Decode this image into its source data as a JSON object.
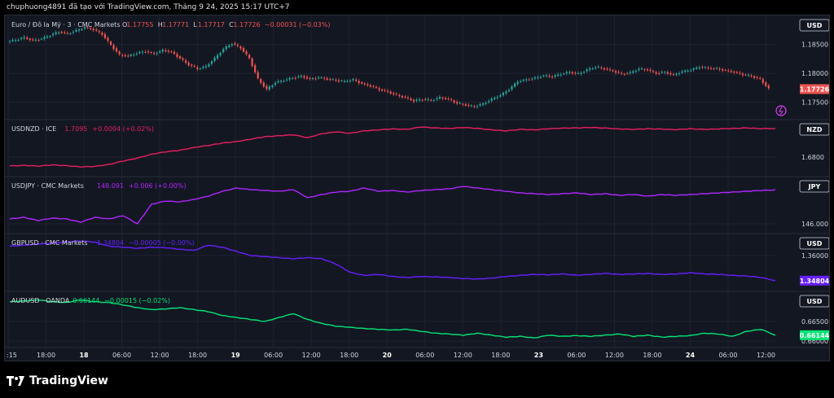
{
  "header": {
    "caption": "chuphuong4891 đã tạo với TradingView.com, Tháng 9 24, 2025 15:17 UTC+7"
  },
  "footer": {
    "brand": "TradingView"
  },
  "colors": {
    "background": "#131722",
    "grid": "#1f2330",
    "up": "#26a69a",
    "down": "#ef5350",
    "usdnzd": "#e91e63",
    "usdjpy": "#b026ff",
    "gbpusd": "#651fff",
    "audusd": "#00e676"
  },
  "chart_data": [
    {
      "id": "eurusd",
      "type": "candlestick",
      "title": "Euro / Đô la Mỹ · 3 · CMC Markets",
      "ohlc_labels": {
        "o_label": "O",
        "o": "1.17755",
        "h_label": "H",
        "h": "1.17771",
        "l_label": "L",
        "l": "1.17717",
        "c_label": "C",
        "c": "1.17726",
        "change": "−0.00031 (−0.03%)"
      },
      "currency": "USD",
      "ticks": [
        "1.18500",
        "1.18000",
        "1.17500"
      ],
      "tick_values": [
        1.185,
        1.18,
        1.175
      ],
      "ylim": [
        1.1728,
        1.1892
      ],
      "last_label": "1.17726",
      "last_value": 1.17726,
      "closes": [
        1.1855,
        1.1858,
        1.1862,
        1.1857,
        1.186,
        1.1866,
        1.1872,
        1.1869,
        1.1874,
        1.188,
        1.1876,
        1.1868,
        1.1849,
        1.1832,
        1.183,
        1.1835,
        1.1838,
        1.1834,
        1.184,
        1.1837,
        1.1826,
        1.1815,
        1.1808,
        1.1812,
        1.1826,
        1.1842,
        1.1852,
        1.1844,
        1.1826,
        1.179,
        1.1772,
        1.1784,
        1.1788,
        1.1792,
        1.1795,
        1.179,
        1.1793,
        1.179,
        1.1788,
        1.1786,
        1.1789,
        1.1782,
        1.1778,
        1.1772,
        1.1768,
        1.1762,
        1.1758,
        1.1752,
        1.1755,
        1.1753,
        1.1758,
        1.1755,
        1.1748,
        1.1745,
        1.1742,
        1.1747,
        1.1755,
        1.1762,
        1.1772,
        1.1786,
        1.1789,
        1.1792,
        1.1796,
        1.1794,
        1.1799,
        1.1802,
        1.1799,
        1.1806,
        1.1811,
        1.1808,
        1.1804,
        1.1799,
        1.1801,
        1.1808,
        1.1806,
        1.18,
        1.1802,
        1.1797,
        1.1803,
        1.1806,
        1.1811,
        1.1809,
        1.1808,
        1.1805,
        1.1802,
        1.1798,
        1.1795,
        1.179,
        1.1773
      ]
    },
    {
      "id": "usdnzd",
      "type": "line",
      "title": "USDNZD · ICE",
      "value": "1.7095",
      "change": "+0.0004 (+0.02%)",
      "currency": "NZD",
      "ticks": [
        "1.6800"
      ],
      "tick_values": [
        1.68
      ],
      "ylim": [
        1.665,
        1.7135
      ],
      "values": [
        1.671,
        1.6715,
        1.6708,
        1.672,
        1.6712,
        1.67,
        1.6705,
        1.6725,
        1.676,
        1.679,
        1.683,
        1.6855,
        1.687,
        1.69,
        1.692,
        1.6945,
        1.696,
        1.6985,
        1.701,
        1.702,
        1.703,
        1.7,
        1.704,
        1.706,
        1.7045,
        1.707,
        1.708,
        1.709,
        1.7085,
        1.711,
        1.71,
        1.7095,
        1.7105,
        1.7095,
        1.708,
        1.707,
        1.7085,
        1.708,
        1.7092,
        1.7098,
        1.71,
        1.7105,
        1.7098,
        1.709,
        1.7085,
        1.7092,
        1.7088,
        1.7082,
        1.7092,
        1.7085,
        1.709,
        1.7095,
        1.71,
        1.7093,
        1.7095
      ]
    },
    {
      "id": "usdjpy",
      "type": "line",
      "title": "USDJPY · CMC Markets",
      "value": "148.091",
      "change": "+0.006 (+0.00%)",
      "currency": "JPY",
      "ticks": [
        "146.000"
      ],
      "tick_values": [
        146.0
      ],
      "ylim": [
        145.7,
        148.6
      ],
      "values": [
        146.3,
        146.4,
        146.2,
        146.35,
        146.3,
        146.1,
        146.4,
        146.3,
        146.5,
        146.0,
        147.2,
        147.4,
        147.35,
        147.5,
        147.7,
        148.0,
        148.2,
        148.1,
        148.05,
        148.0,
        148.1,
        147.6,
        147.8,
        147.95,
        148.0,
        148.2,
        148.0,
        148.05,
        147.95,
        148.05,
        148.1,
        148.15,
        148.3,
        148.2,
        148.1,
        148.0,
        147.9,
        147.85,
        147.8,
        147.85,
        147.9,
        147.8,
        147.85,
        147.75,
        147.8,
        147.7,
        147.8,
        147.75,
        147.8,
        147.85,
        147.9,
        147.95,
        148.0,
        148.05,
        148.09
      ]
    },
    {
      "id": "gbpusd",
      "type": "line",
      "title": "GBPUSD · CMC Markets",
      "value": "1.34804",
      "change": "−0.00005 (−0.00%)",
      "currency": "USD",
      "ticks": [
        "1.36000"
      ],
      "tick_values": [
        1.36
      ],
      "ylim": [
        1.3452,
        1.3682
      ],
      "values": [
        1.3645,
        1.365,
        1.3655,
        1.366,
        1.3665,
        1.367,
        1.3665,
        1.3645,
        1.364,
        1.3635,
        1.364,
        1.3638,
        1.363,
        1.3625,
        1.365,
        1.364,
        1.362,
        1.36,
        1.3595,
        1.359,
        1.3585,
        1.359,
        1.3585,
        1.356,
        1.352,
        1.3505,
        1.351,
        1.35,
        1.3495,
        1.35,
        1.3498,
        1.3495,
        1.349,
        1.3488,
        1.3492,
        1.35,
        1.3505,
        1.351,
        1.3508,
        1.3512,
        1.3506,
        1.351,
        1.3515,
        1.351,
        1.3512,
        1.3514,
        1.351,
        1.3512,
        1.3518,
        1.3512,
        1.351,
        1.3505,
        1.3502,
        1.3495,
        1.348
      ]
    },
    {
      "id": "audusd",
      "type": "line",
      "title": "AUDUSD · OANDA",
      "value": "0.66144",
      "change": "−0.00015 (−0.02%)",
      "currency": "USD",
      "ticks": [
        "0.66500",
        "0.66000"
      ],
      "tick_values": [
        0.665,
        0.66
      ],
      "ylim": [
        0.6596,
        0.6714
      ],
      "values": [
        0.67,
        0.6702,
        0.6705,
        0.67,
        0.6698,
        0.6705,
        0.67,
        0.6698,
        0.6692,
        0.6685,
        0.668,
        0.6682,
        0.6685,
        0.668,
        0.6675,
        0.6665,
        0.666,
        0.6655,
        0.665,
        0.666,
        0.667,
        0.6655,
        0.6645,
        0.6638,
        0.6635,
        0.6632,
        0.663,
        0.6628,
        0.663,
        0.6625,
        0.662,
        0.6618,
        0.6615,
        0.662,
        0.6615,
        0.661,
        0.6612,
        0.6608,
        0.6615,
        0.6612,
        0.6614,
        0.6612,
        0.6615,
        0.6618,
        0.6612,
        0.6615,
        0.661,
        0.6612,
        0.6614,
        0.662,
        0.6618,
        0.6612,
        0.6625,
        0.663,
        0.6615
      ]
    }
  ],
  "time_axis": {
    "labels": [
      ":15",
      "18:00",
      "18",
      "06:00",
      "12:00",
      "18:00",
      "19",
      "06:00",
      "12:00",
      "18:00",
      "20",
      "06:00",
      "12:00",
      "18:00",
      "23",
      "06:00",
      "12:00",
      "18:00",
      "24",
      "06:00",
      "12:00"
    ],
    "bold": [
      false,
      false,
      true,
      false,
      false,
      false,
      true,
      false,
      false,
      false,
      true,
      false,
      false,
      false,
      true,
      false,
      false,
      false,
      true,
      false,
      false
    ]
  }
}
